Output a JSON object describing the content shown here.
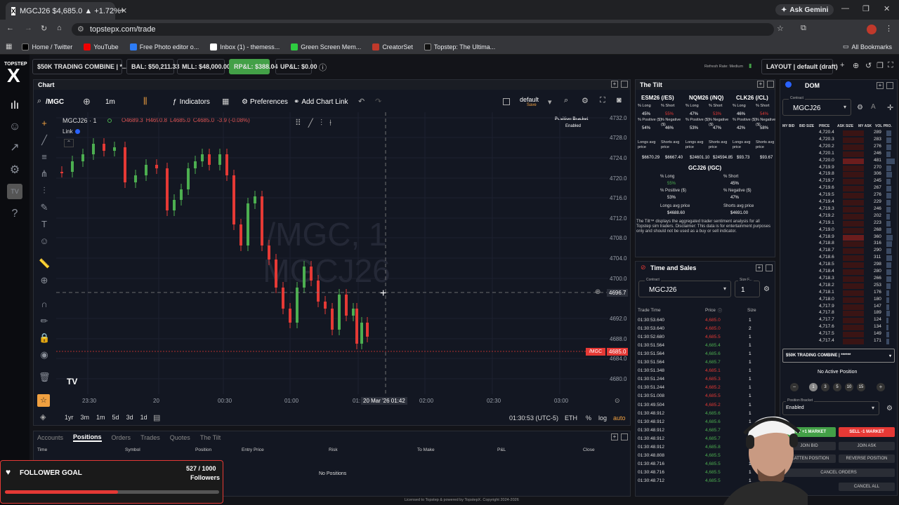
{
  "browser": {
    "tab_title": "MGCJ26 $4,685.0 ▲ +1.72%",
    "url": "topstepx.com/trade",
    "gemini": "Ask Gemini",
    "bookmarks": [
      "Home / Twitter",
      "YouTube",
      "Free Photo editor o...",
      "Inbox (1) - themess...",
      "Green Screen Mem...",
      "CreatorSet",
      "Topstep: The Ultima..."
    ],
    "all_bookmarks": "All Bookmarks"
  },
  "brand": {
    "name": "TOPSTEP",
    "logo": "X"
  },
  "topbar": {
    "account": "$50K TRADING COMBINE | *...",
    "bal": "BAL: $50,211.33",
    "mll": "MLL: $48,000.00",
    "rpl": "RP&L: $388.04",
    "upl": "UP&L: $0.00",
    "refresh": "Refresh Rate: Medium",
    "layout": "LAYOUT | default (draft)"
  },
  "chart": {
    "panel_title": "Chart",
    "symbol_search": "/MGC",
    "interval": "1m",
    "indicators": "Indicators",
    "preferences": "Preferences",
    "add_chart_link": "Add Chart Link",
    "layout_name": "default",
    "layout_save": "Save",
    "legend_symbol": "MGCJ26 · 1",
    "ohlc": {
      "o": "O4689.3",
      "h": "H4690.8",
      "l": "L4685.0",
      "c": "C4685.0",
      "chg": "-3.9 (-0.08%)"
    },
    "link": "Link",
    "watermark1": "/MGC, 1",
    "watermark2": "MGCJ26",
    "position_bracket": "Position Bracket",
    "position_bracket_state": "Enabled",
    "y_ticks": [
      "4732.0",
      "4728.0",
      "4724.0",
      "4720.0",
      "4716.0",
      "4712.0",
      "4708.0",
      "4704.0",
      "4700.0",
      "4692.0",
      "4688.0",
      "4684.0",
      "4680.0"
    ],
    "crosshair_price": "4696.7",
    "last_symbol": "/MGC",
    "last_price": "4685.0",
    "x_ticks": [
      "23:30",
      "20",
      "00:30",
      "01:00",
      "01:",
      "02:00",
      "02:30",
      "03:00"
    ],
    "crosshair_time": "20 Mar '26  01:42",
    "ranges": [
      "1yr",
      "3m",
      "1m",
      "5d",
      "3d",
      "1d"
    ],
    "clock": "01:30:53 (UTC-5)",
    "session": "ETH",
    "pct": "%",
    "log": "log",
    "auto": "auto"
  },
  "chart_data": {
    "type": "line",
    "note_symbol": "MGCJ26",
    "x": [
      "23:30",
      "20",
      "00:30",
      "01:00",
      "01:42"
    ],
    "ylim": [
      4680,
      4732
    ]
  },
  "bottom": {
    "tabs": [
      "Accounts",
      "Positions",
      "Orders",
      "Trades",
      "Quotes",
      "The Tilt"
    ],
    "columns": [
      "Time",
      "Symbol",
      "Position",
      "Entry Price",
      "Risk",
      "To Make",
      "P&L",
      "Close"
    ],
    "empty": "No Positions",
    "footer": "Licensed to Topstep & powered by TopstepX. Copyright 2024-2026"
  },
  "goal": {
    "title": "FOLLOWER GOAL",
    "count": "527 / 1000",
    "label": "Followers",
    "fraction": 0.527
  },
  "tilt": {
    "title": "The Tilt",
    "cols": [
      {
        "name": "ESM26 (/ES)",
        "long": "45%",
        "short": "55%",
        "pos": "54%",
        "neg": "46%",
        "lavg": "$6670.29",
        "savg": "$6667.40"
      },
      {
        "name": "NQM26 (/NQ)",
        "long": "47%",
        "short": "53%",
        "pos": "53%",
        "neg": "47%",
        "lavg": "$24601.10",
        "savg": "$24594.85"
      },
      {
        "name": "CLK26 (/CL)",
        "long": "46%",
        "short": "54%",
        "pos": "42%",
        "neg": "58%",
        "lavg": "$93.73",
        "savg": "$93.67"
      }
    ],
    "labels": {
      "long": "% Long",
      "short": "% Short",
      "pos": "% Positive ($)",
      "neg": "% Negative ($)",
      "lavg": "Longs avg price",
      "savg": "Shorts avg price"
    },
    "gc": {
      "name": "GCJ26 (/GC)",
      "long": "55%",
      "short": "45%",
      "pos": "53%",
      "neg": "47%",
      "lavg": "$4688.60",
      "savg": "$4691.00"
    },
    "disclaimer": "The Tilt™ displays the aggregated trader sentiment analysis for all Topstep sim traders. Disclaimer: This data is for entertainment purposes only and should not be used as a buy or sell indicator."
  },
  "ts": {
    "title": "Time and Sales",
    "contract_label": "Contract",
    "contract": "MGCJ26",
    "size_label": "Size F...",
    "size": "1",
    "headers": [
      "Trade Time",
      "Price",
      "Size"
    ],
    "rows": [
      [
        "01:30:53.640",
        "4,685.0",
        "1",
        "r"
      ],
      [
        "01:30:53.640",
        "4,685.0",
        "2",
        "r"
      ],
      [
        "01:30:52.680",
        "4,685.5",
        "1",
        "r"
      ],
      [
        "01:30:51.564",
        "4,685.4",
        "1",
        "g"
      ],
      [
        "01:30:51.564",
        "4,685.6",
        "1",
        "g"
      ],
      [
        "01:30:51.564",
        "4,685.7",
        "1",
        "g"
      ],
      [
        "01:30:51.348",
        "4,685.1",
        "1",
        "r"
      ],
      [
        "01:30:51.244",
        "4,685.3",
        "1",
        "r"
      ],
      [
        "01:30:51.244",
        "4,685.2",
        "1",
        "r"
      ],
      [
        "01:30:51.008",
        "4,685.5",
        "1",
        "r"
      ],
      [
        "01:30:49.504",
        "4,685.2",
        "1",
        "r"
      ],
      [
        "01:30:48.912",
        "4,685.6",
        "1",
        "g"
      ],
      [
        "01:30:48.912",
        "4,685.6",
        "1",
        "g"
      ],
      [
        "01:30:48.912",
        "4,685.7",
        "1",
        "g"
      ],
      [
        "01:30:48.912",
        "4,685.7",
        "1",
        "g"
      ],
      [
        "01:30:48.912",
        "4,685.8",
        "1",
        "g"
      ],
      [
        "01:30:48.808",
        "4,685.5",
        "1",
        "g"
      ],
      [
        "01:30:48.716",
        "4,685.5",
        "1",
        "g"
      ],
      [
        "01:30:48.716",
        "4,685.5",
        "1",
        "g"
      ],
      [
        "01:30:48.712",
        "4,685.5",
        "1",
        "g"
      ]
    ]
  },
  "dom": {
    "title": "DOM",
    "contract_label": "Contract",
    "contract": "MGCJ26",
    "headers": [
      "MY BID",
      "BID SIZE",
      "PRICE",
      "ASK SIZE",
      "MY ASK",
      "VOL PRO."
    ],
    "prices": [
      "4,720.4",
      "4,720.3",
      "4,720.2",
      "4,720.1",
      "4,720.0",
      "4,719.9",
      "4,719.8",
      "4,719.7",
      "4,719.6",
      "4,719.5",
      "4,719.4",
      "4,719.3",
      "4,719.2",
      "4,719.1",
      "4,719.0",
      "4,718.9",
      "4,718.8",
      "4,718.7",
      "4,718.6",
      "4,718.5",
      "4,718.4",
      "4,718.3",
      "4,718.2",
      "4,718.1",
      "4,718.0",
      "4,717.9",
      "4,717.8",
      "4,717.7",
      "4,717.6",
      "4,717.5",
      "4,717.4"
    ],
    "vols": [
      "289",
      "283",
      "276",
      "246",
      "481",
      "270",
      "306",
      "245",
      "267",
      "276",
      "229",
      "246",
      "202",
      "223",
      "268",
      "360",
      "316",
      "290",
      "311",
      "298",
      "280",
      "266",
      "253",
      "176",
      "180",
      "147",
      "189",
      "124",
      "134",
      "149",
      "171"
    ],
    "account": "$50K TRADING COMBINE | ******",
    "no_position": "No Active Position",
    "qty": [
      "1",
      "3",
      "5",
      "10",
      "15"
    ],
    "bracket_label": "Position Bracket",
    "bracket": "Enabled",
    "buy": "BUY +1 MARKET",
    "sell": "SELL -1 MARKET",
    "join_bid": "JOIN BID",
    "join_ask": "JOIN ASK",
    "flatten": "FLATTEN POSITION",
    "reverse": "REVERSE POSITION",
    "cancel_orders": "CANCEL ORDERS",
    "cancel_all": "CANCEL ALL"
  }
}
